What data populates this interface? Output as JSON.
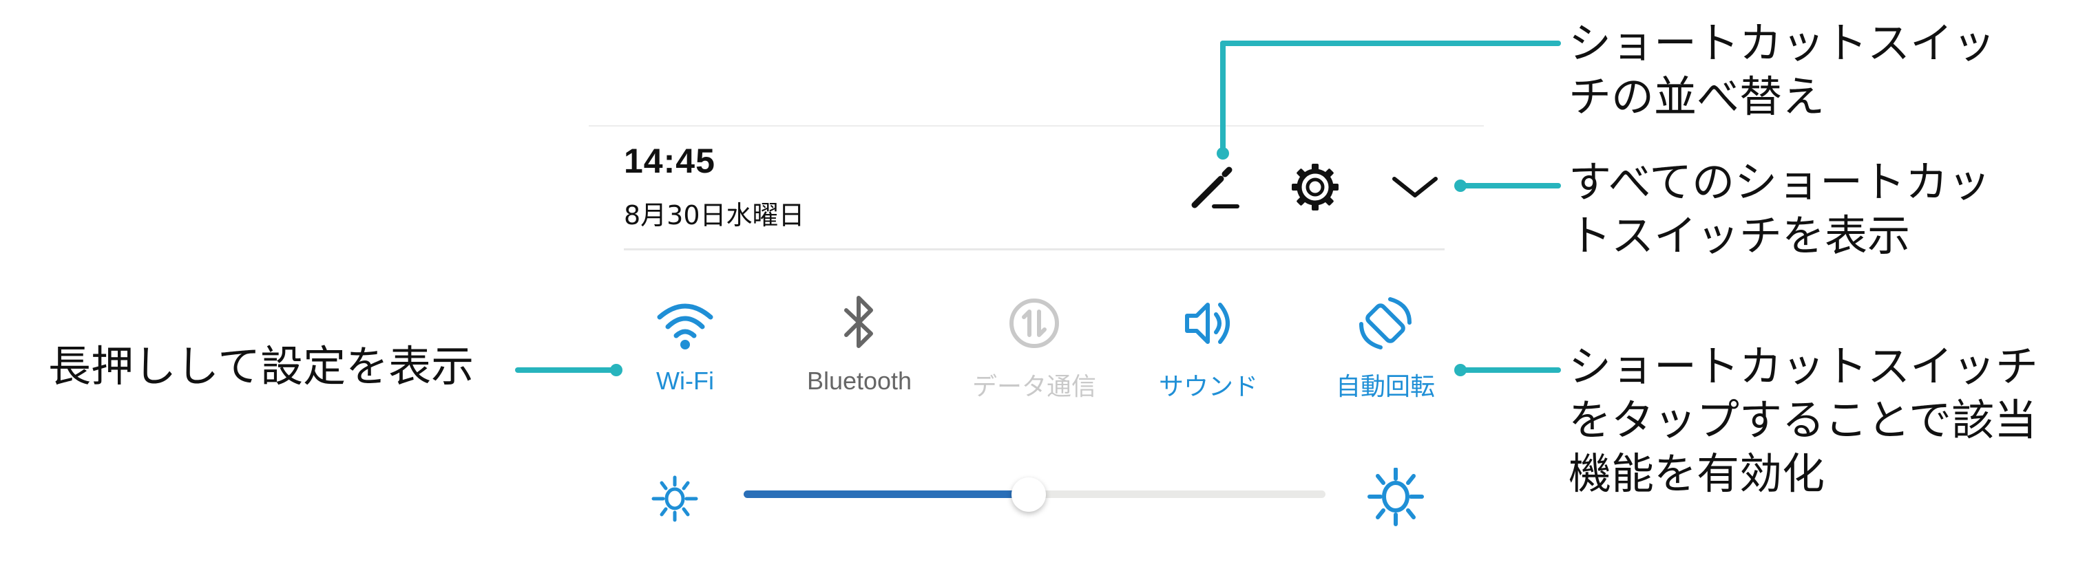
{
  "status": {
    "time": "14:45",
    "date": "8月30日水曜日"
  },
  "header_icons": [
    {
      "name": "edit-shortcuts-icon",
      "label": "edit"
    },
    {
      "name": "settings-gear-icon",
      "label": "settings"
    },
    {
      "name": "expand-chevron-down-icon",
      "label": "expand"
    }
  ],
  "toggles": [
    {
      "label": "Wi-Fi",
      "icon": "wifi-icon",
      "state": "on",
      "color": "#1f8fd6"
    },
    {
      "label": "Bluetooth",
      "icon": "bluetooth-icon",
      "state": "off",
      "color": "#666666"
    },
    {
      "label": "データ通信",
      "icon": "mobile-data-icon",
      "state": "disabled",
      "color": "#c9c9c9"
    },
    {
      "label": "サウンド",
      "icon": "sound-icon",
      "state": "on",
      "color": "#1f8fd6"
    },
    {
      "label": "自動回転",
      "icon": "auto-rotate-icon",
      "state": "on",
      "color": "#1f8fd6"
    }
  ],
  "brightness": {
    "value_fraction": 0.49,
    "fill_color": "#2a6fb8",
    "icon_color": "#1f8fd6"
  },
  "callouts": {
    "reorder": "ショートカットスイッ\nチの並べ替え",
    "show_all": "すべてのショートカッ\nトスイッチを表示",
    "long_press": "長押しして設定を表示",
    "tap_enable": "ショートカットスイッチ\nをタップすることで該当\n機能を有効化"
  },
  "colors": {
    "leader": "#27b4bd",
    "accent": "#1f8fd6"
  }
}
